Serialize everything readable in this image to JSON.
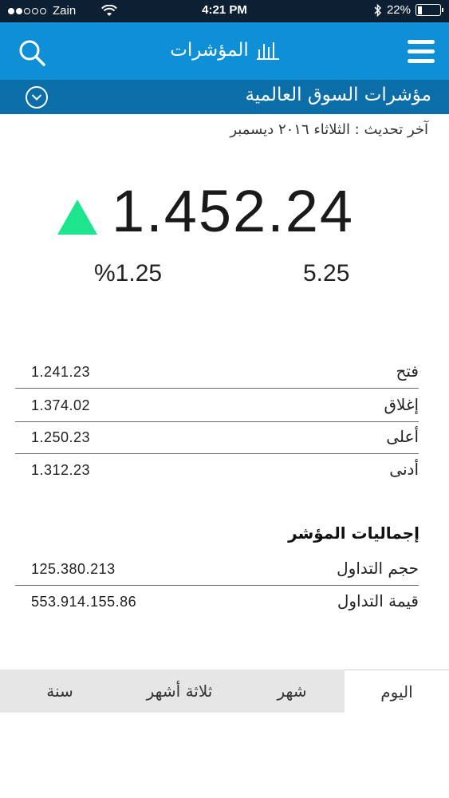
{
  "status_bar": {
    "carrier": "Zain",
    "time": "4:21 PM",
    "battery": "22%",
    "battery_level": 0.22
  },
  "header": {
    "title": "المؤشرات",
    "search_icon": "search-icon",
    "menu_icon": "hamburger-menu-icon",
    "title_icon": "bar-chart-icon"
  },
  "section": {
    "title": "مؤشرات السوق العالمية",
    "dropdown_icon": "chevron-down-icon"
  },
  "last_updated": "آخر تحديث : الثلاثاء ٢٠١٦ ديسمبر",
  "quote": {
    "value": "1.452.24",
    "change_percent": "%1.25",
    "change": "5.25",
    "trend": "up",
    "trend_color": "#1de58d"
  },
  "stats": [
    {
      "label": "فتح",
      "value": "1.241.23"
    },
    {
      "label": "إغلاق",
      "value": "1.374.02"
    },
    {
      "label": "أعلى",
      "value": "1.250.23"
    },
    {
      "label": "أدنى",
      "value": "1.312.23"
    }
  ],
  "totals": {
    "heading": "إجماليات المؤشر",
    "items": [
      {
        "label": "حجم التداول",
        "value": "125.380.213"
      },
      {
        "label": "قيمة التداول",
        "value": "553.914.155.86"
      }
    ]
  },
  "tabs": [
    {
      "label": "اليوم",
      "active": true
    },
    {
      "label": "شهر",
      "active": false
    },
    {
      "label": "ثلاثة أشهر",
      "active": false
    },
    {
      "label": "سنة",
      "active": false
    }
  ],
  "colors": {
    "header": "#0f8fd6",
    "section_bar": "#0b6ea8",
    "status_bar": "#0d1f33"
  }
}
